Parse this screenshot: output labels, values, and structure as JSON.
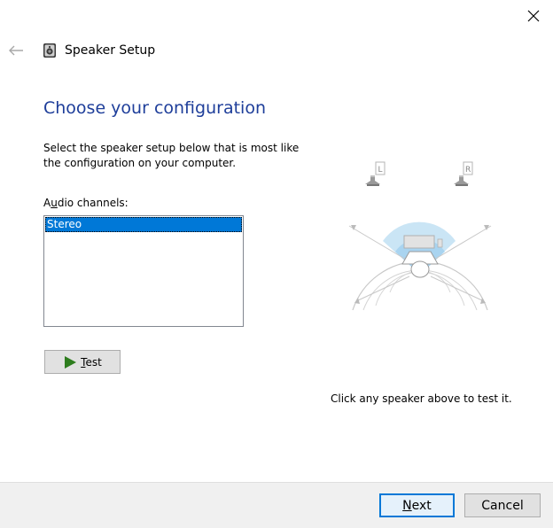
{
  "window": {
    "title": "Speaker Setup"
  },
  "page": {
    "heading": "Choose your configuration",
    "instruction": "Select the speaker setup below that is most like the configuration on your computer.",
    "channels_label_pre": "A",
    "channels_label_underlined": "u",
    "channels_label_post": "dio channels:",
    "channels": [
      "Stereo"
    ],
    "selected_channel": "Stereo",
    "test_button_underlined": "T",
    "test_button_rest": "est",
    "hint": "Click any speaker above to test it.",
    "speaker_labels": {
      "left": "L",
      "right": "R"
    }
  },
  "footer": {
    "next_underlined": "N",
    "next_rest": "ext",
    "cancel_label": "Cancel"
  },
  "colors": {
    "heading": "#1e3e9a",
    "selection": "#0078d7",
    "test_arrow": "#2e7d1e"
  },
  "icons": [
    "close-icon",
    "back-arrow-icon",
    "speaker-app-icon",
    "play-icon"
  ]
}
